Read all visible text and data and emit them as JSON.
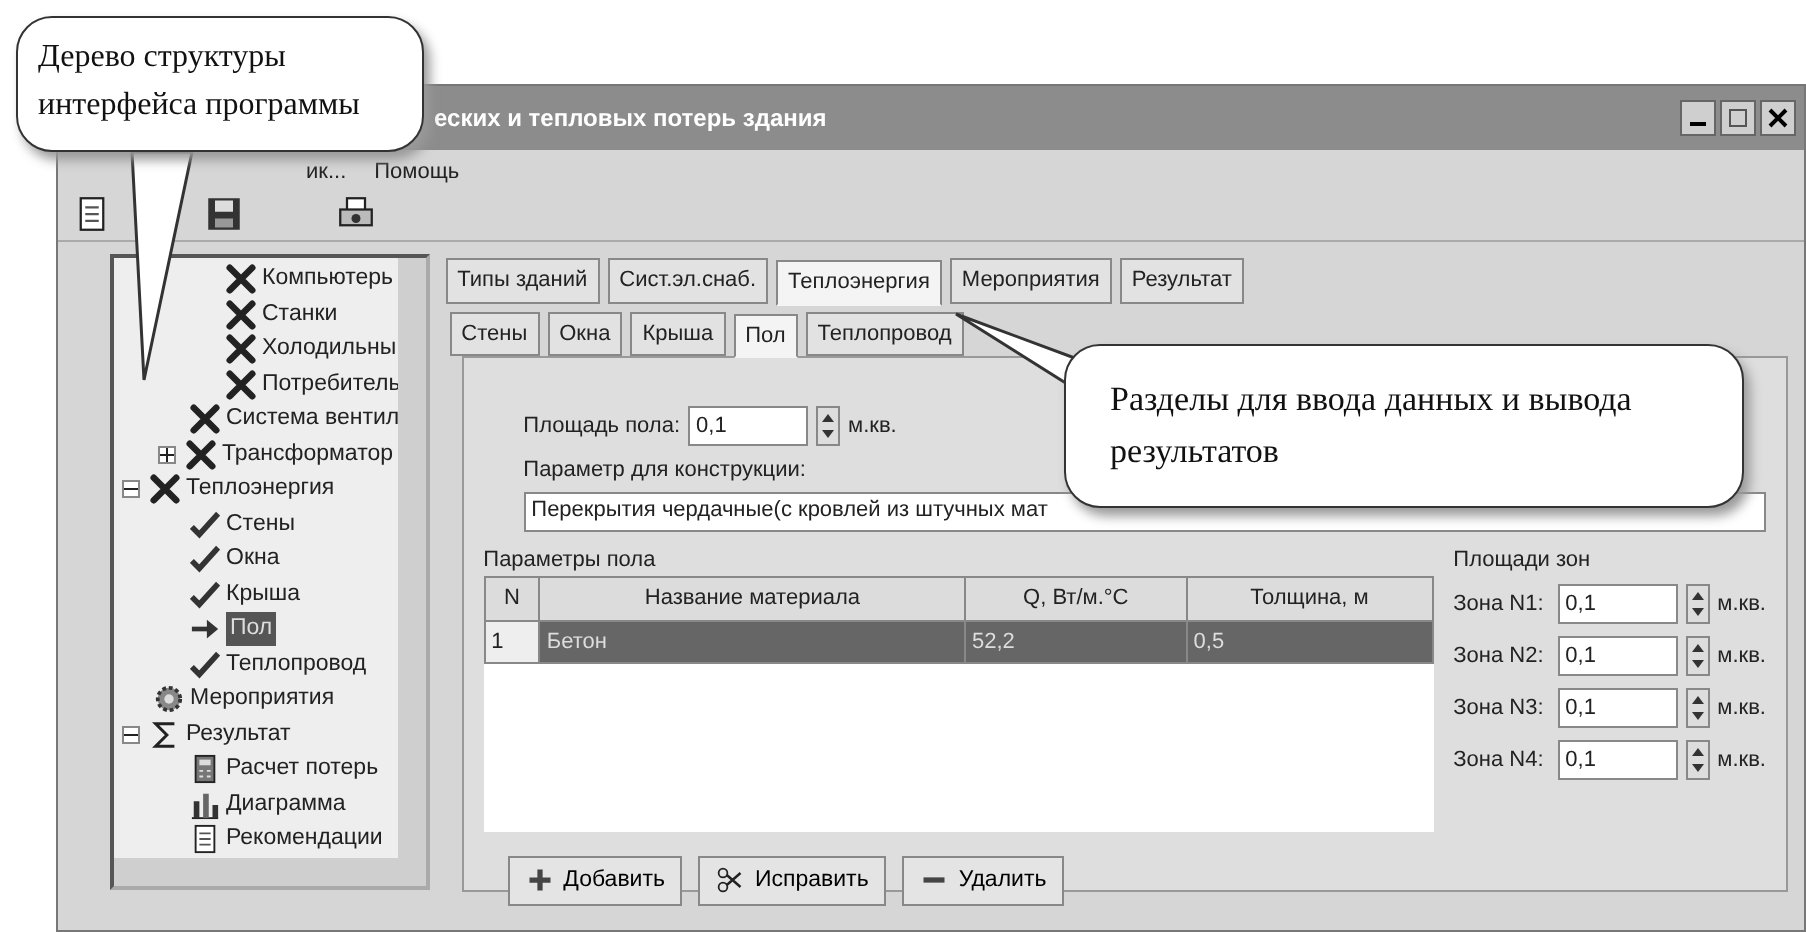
{
  "callouts": [
    {
      "text": "Дерево структуры интерфейса программы"
    },
    {
      "text": "Разделы для ввода данных и вывода результатов"
    }
  ],
  "window": {
    "title": "еских и тепловых потерь здания"
  },
  "menu": [
    "ик...",
    "Помощь"
  ],
  "toolbar": [
    {
      "kind": "document"
    },
    {
      "kind": "disk"
    },
    {
      "kind": "printer"
    }
  ],
  "tree": [
    {
      "children": [
        {
          "children": [
            {
              "label": "Компьютерь",
              "kind": "cross",
              "selected": false
            },
            {
              "label": "Станки",
              "kind": "cross",
              "selected": false
            },
            {
              "label": "Холодильны",
              "kind": "cross",
              "selected": false
            },
            {
              "label": "Потребитель",
              "kind": "cross",
              "selected": false
            }
          ]
        },
        {
          "label": "Система вентил",
          "kind": "cross",
          "selected": false
        },
        {
          "label": "Трансформатор",
          "kind": "cross",
          "selected": false,
          "expanded": false
        }
      ]
    },
    {
      "label": "Теплоэнергия",
      "kind": "cross",
      "selected": false,
      "expanded": true,
      "children": [
        {
          "label": "Стены",
          "kind": "check",
          "selected": false
        },
        {
          "label": "Окна",
          "kind": "check",
          "selected": false
        },
        {
          "label": "Крыша",
          "kind": "check",
          "selected": false
        },
        {
          "label": "Пол",
          "kind": "arrow",
          "selected": true
        },
        {
          "label": "Теплопровод",
          "kind": "check",
          "selected": false
        }
      ]
    },
    {
      "label": "Мероприятия",
      "kind": "gear",
      "selected": false
    },
    {
      "label": "Результат",
      "kind": "sigma",
      "selected": false,
      "expanded": true,
      "children": [
        {
          "label": "Расчет потерь",
          "kind": "calculator",
          "selected": false
        },
        {
          "label": "Диаграмма",
          "kind": "chart",
          "selected": false
        },
        {
          "label": "Рекомендации",
          "kind": "document",
          "selected": false
        }
      ]
    }
  ],
  "tabs": [
    {
      "label": "Типы зданий",
      "selected": false
    },
    {
      "label": "Сист.эл.снаб.",
      "selected": false
    },
    {
      "label": "Теплоэнергия",
      "selected": true
    },
    {
      "label": "Мероприятия",
      "selected": false
    },
    {
      "label": "Результат",
      "selected": false
    }
  ],
  "subtabs": [
    {
      "label": "Стены",
      "selected": false
    },
    {
      "label": "Окна",
      "selected": false
    },
    {
      "label": "Крыша",
      "selected": false
    },
    {
      "label": "Пол",
      "selected": true
    },
    {
      "label": "Теплопровод",
      "selected": false
    }
  ],
  "floor_area": {
    "label": "Площадь пола:",
    "value": "0,1",
    "unit": "м.кв."
  },
  "construction": {
    "label": "Параметр для конструкции:",
    "value": "Перекрытия чердачные(с кровлей из штучных мат"
  },
  "floor_params": {
    "title": "Параметры пола",
    "columns": [
      "N",
      "Название материала",
      "Q, Вт/м.°С",
      "Толщина, м"
    ],
    "rows": [
      {
        "cells": [
          "1",
          "Бетон",
          "52,2",
          "0,5"
        ],
        "selected": true
      }
    ]
  },
  "zones": {
    "title": "Площади зон",
    "items": [
      {
        "label": "Зона N1:",
        "value": "0,1",
        "unit": "м.кв."
      },
      {
        "label": "Зона N2:",
        "value": "0,1",
        "unit": "м.кв."
      },
      {
        "label": "Зона N3:",
        "value": "0,1",
        "unit": "м.кв."
      },
      {
        "label": "Зона N4:",
        "value": "0,1",
        "unit": "м.кв."
      }
    ]
  },
  "buttons": [
    {
      "label": "Добавить",
      "kind": "plus"
    },
    {
      "label": "Исправить",
      "kind": "edit"
    },
    {
      "label": "Удалить",
      "kind": "minus"
    }
  ]
}
